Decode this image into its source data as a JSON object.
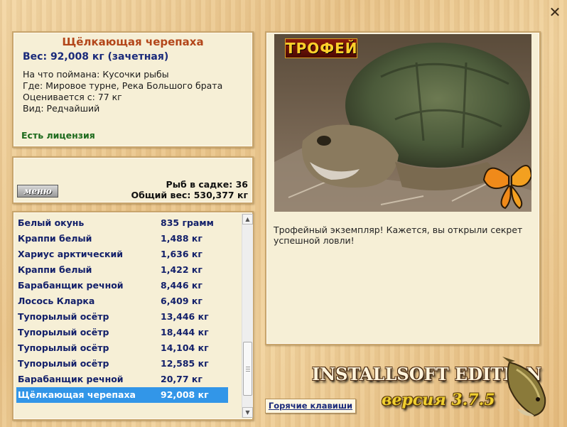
{
  "window": {
    "close_glyph": "✕"
  },
  "info": {
    "title": "Щёлкающая черепаха",
    "weight": "Вес: 92,008 кг (зачетная)",
    "caught_on": "На что поймана: Кусочки рыбы",
    "where": "Где: Мировое турне, Река Большого брата",
    "valued_from": "Оценивается с: 77 кг",
    "kind": "Вид: Редчайший",
    "license": "Есть лицензия"
  },
  "menu": {
    "button_label": "меню",
    "fish_in_keepnet": "Рыб в садке: 36",
    "total_weight": "Общий вес: 530,377 кг"
  },
  "catch_list": [
    {
      "name": "Белый окунь",
      "weight": "835 грамм"
    },
    {
      "name": "Краппи белый",
      "weight": "1,488 кг"
    },
    {
      "name": "Хариус арктический",
      "weight": "1,636 кг"
    },
    {
      "name": "Краппи белый",
      "weight": "1,422 кг"
    },
    {
      "name": "Барабанщик речной",
      "weight": "8,446 кг"
    },
    {
      "name": "Лосось Кларка",
      "weight": "6,409 кг"
    },
    {
      "name": "Тупорылый осётр",
      "weight": "13,446 кг"
    },
    {
      "name": "Тупорылый осётр",
      "weight": "18,444 кг"
    },
    {
      "name": "Тупорылый осётр",
      "weight": "14,104 кг"
    },
    {
      "name": "Тупорылый осётр",
      "weight": "12,585 кг"
    },
    {
      "name": "Барабанщик речной",
      "weight": "20,77 кг"
    },
    {
      "name": "Щёлкающая черепаха",
      "weight": "92,008 кг",
      "selected": true
    }
  ],
  "photo": {
    "badge": "ТРОФЕЙ",
    "description": "Трофейный экземпляр! Кажется, вы открыли секрет успешной ловли!"
  },
  "footer": {
    "hotkeys_label": "Горячие клавиши",
    "edition": "INSTALLSOFT EDITION",
    "version": "версия 3.7.5"
  },
  "colors": {
    "title": "#b3461a",
    "weight": "#1a2a7a",
    "license": "#1c6a1c",
    "list_text": "#13206a",
    "selection": "#3296e8"
  }
}
